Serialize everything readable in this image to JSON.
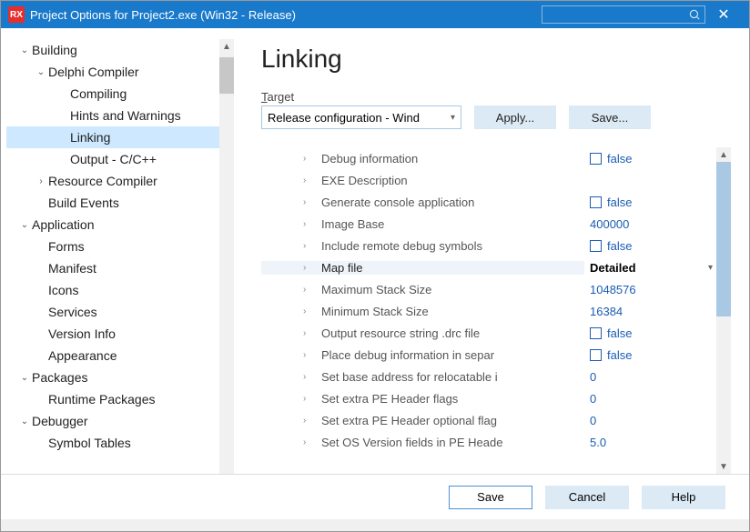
{
  "window": {
    "title": "Project Options for Project2.exe  (Win32 - Release)",
    "logo_text": "RX"
  },
  "tree": [
    {
      "label": "Building",
      "level": 0,
      "chev": "v"
    },
    {
      "label": "Delphi Compiler",
      "level": 1,
      "chev": "v"
    },
    {
      "label": "Compiling",
      "level": 2,
      "chev": ""
    },
    {
      "label": "Hints and Warnings",
      "level": 2,
      "chev": ""
    },
    {
      "label": "Linking",
      "level": 2,
      "chev": "",
      "selected": true
    },
    {
      "label": "Output - C/C++",
      "level": 2,
      "chev": ""
    },
    {
      "label": "Resource Compiler",
      "level": 1,
      "chev": ">"
    },
    {
      "label": "Build Events",
      "level": 1,
      "chev": ""
    },
    {
      "label": "Application",
      "level": 0,
      "chev": "v"
    },
    {
      "label": "Forms",
      "level": 1,
      "chev": ""
    },
    {
      "label": "Manifest",
      "level": 1,
      "chev": ""
    },
    {
      "label": "Icons",
      "level": 1,
      "chev": ""
    },
    {
      "label": "Services",
      "level": 1,
      "chev": ""
    },
    {
      "label": "Version Info",
      "level": 1,
      "chev": ""
    },
    {
      "label": "Appearance",
      "level": 1,
      "chev": ""
    },
    {
      "label": "Packages",
      "level": 0,
      "chev": "v"
    },
    {
      "label": "Runtime Packages",
      "level": 1,
      "chev": ""
    },
    {
      "label": "Debugger",
      "level": 0,
      "chev": "v"
    },
    {
      "label": "Symbol Tables",
      "level": 1,
      "chev": ""
    }
  ],
  "main": {
    "heading": "Linking",
    "target_label_pre": "T",
    "target_label_rest": "arget",
    "target_value": "Release configuration - Wind",
    "apply_label": "Apply...",
    "save_label": "Save..."
  },
  "grid": [
    {
      "key": "Debug information",
      "val": "false",
      "cb": true
    },
    {
      "key": "EXE Description",
      "val": ""
    },
    {
      "key": "Generate console application",
      "val": "false",
      "cb": true
    },
    {
      "key": "Image Base",
      "val": "400000"
    },
    {
      "key": "Include remote debug symbols",
      "val": "false",
      "cb": true
    },
    {
      "key": "Map file",
      "val": "Detailed",
      "selected": true,
      "drop": true
    },
    {
      "key": "Maximum Stack Size",
      "val": "1048576"
    },
    {
      "key": "Minimum Stack Size",
      "val": "16384"
    },
    {
      "key": "Output resource string .drc file",
      "val": "false",
      "cb": true
    },
    {
      "key": "Place debug information in separ",
      "val": "false",
      "cb": true
    },
    {
      "key": "Set base address for relocatable i",
      "val": "0"
    },
    {
      "key": "Set extra PE Header flags",
      "val": "0"
    },
    {
      "key": "Set extra PE Header optional flag",
      "val": "0"
    },
    {
      "key": "Set OS Version fields in PE Heade",
      "val": "5.0"
    }
  ],
  "footer": {
    "save": "Save",
    "cancel": "Cancel",
    "help": "Help"
  }
}
